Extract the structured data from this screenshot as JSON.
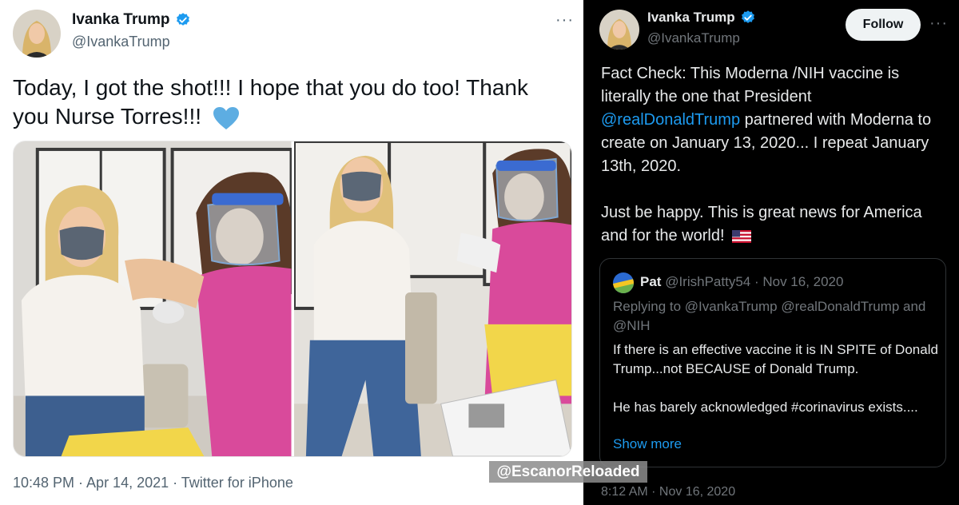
{
  "colors": {
    "light_bg": "#ffffff",
    "dark_bg": "#000000",
    "verified_blue": "#1d9bf0",
    "link_blue": "#1d9bf0",
    "secondary_text_light": "#536471",
    "secondary_text_dark": "#71767b"
  },
  "left_tweet": {
    "author_name": "Ivanka Trump",
    "handle": "@IvankaTrump",
    "more_icon": "more-horizontal-icon",
    "text": "Today, I got the shot!!! I hope that you do too! Thank you Nurse Torres!!!",
    "emoji_icon": "blue-heart-icon",
    "meta": "10:48 PM · Apr 14, 2021 · Twitter for iPhone"
  },
  "right_tweet": {
    "author_name": "Ivanka Trump",
    "handle": "@IvankaTrump",
    "follow_label": "Follow",
    "more_icon": "more-horizontal-icon",
    "text_part1": "Fact Check: This Moderna /NIH vaccine is literally the one that President ",
    "mention": "@realDonaldTrump",
    "text_part2": " partnered with Moderna to create on January 13, 2020... I repeat January 13th, 2020.",
    "text_part3": "Just be happy. This is great news for America and for the world!",
    "flag_icon": "us-flag-icon",
    "meta": "8:12 AM · Nov 16, 2020"
  },
  "quoted_tweet": {
    "author_name": "Pat",
    "handle_date": "@IrishPatty54 · Nov 16, 2020",
    "replying_to": "Replying to @IvankaTrump @realDonaldTrump and @NIH",
    "body_line1": "If there is an effective vaccine it is IN SPITE of Donald Trump...not BECAUSE of Donald Trump.",
    "body_line2": "He has barely acknowledged #corinavirus exists....",
    "show_more": "Show more"
  },
  "watermark": "@EscanorReloaded"
}
